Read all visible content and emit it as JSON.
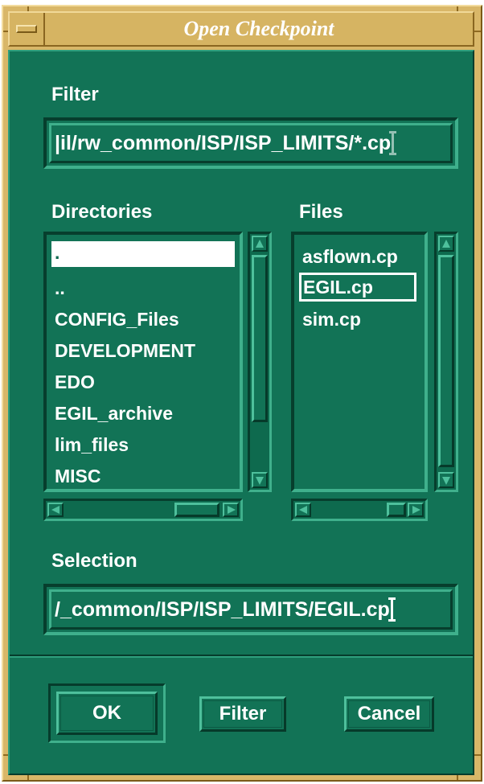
{
  "window": {
    "title": "Open Checkpoint"
  },
  "filter": {
    "label": "Filter",
    "value": "|il/rw_common/ISP/ISP_LIMITS/*.cp"
  },
  "directories": {
    "label": "Directories",
    "items": [
      ".",
      "..",
      "CONFIG_Files",
      "DEVELOPMENT",
      "EDO",
      "EGIL_archive",
      "lim_files",
      "MISC"
    ],
    "selected_index": 0
  },
  "files": {
    "label": "Files",
    "items": [
      "asflown.cp",
      "EGIL.cp",
      "sim.cp"
    ],
    "selected_index": 1
  },
  "selection": {
    "label": "Selection",
    "value": "/_common/ISP/ISP_LIMITS/EGIL.cp"
  },
  "buttons": {
    "ok": "OK",
    "filter": "Filter",
    "cancel": "Cancel"
  },
  "colors": {
    "dialog_bg": "#127356",
    "frame": "#d9b768",
    "text": "#ffffff"
  }
}
